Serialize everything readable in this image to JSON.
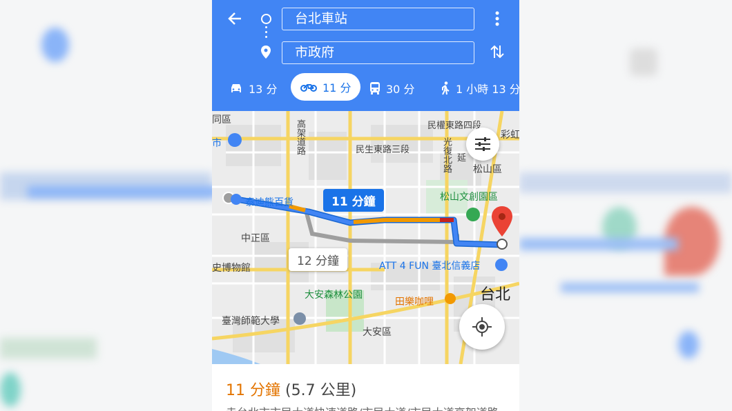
{
  "header": {
    "origin": "台北車站",
    "destination": "市政府"
  },
  "modes": [
    {
      "icon": "car-icon",
      "label": "13 分"
    },
    {
      "icon": "motorcycle-icon",
      "label": "11 分"
    },
    {
      "icon": "bus-icon",
      "label": "30 分"
    },
    {
      "icon": "walk-icon",
      "label": "1 小時 13 分"
    }
  ],
  "map": {
    "labels": {
      "district_datong": "同區",
      "xinnan_market": "市",
      "elevated": "高架道路",
      "minquan": "民權東路四段",
      "minsheng": "民生東路三段",
      "guangfu": "光復北路",
      "rainbow": "彩虹",
      "songshan": "松山區",
      "songshan_park": "松山文創園區",
      "teddy": "泰迪熊百貨",
      "zhongzheng": "中正區",
      "museum": "史博物館",
      "att": "ATT 4 FUN 臺北信義店",
      "taipei": "台北",
      "daan_park": "大安森林公園",
      "tianle": "田樂咖哩",
      "ntnu": "臺灣師範大學",
      "daan": "大安區",
      "yan": "延"
    },
    "route_label": "11 分鐘",
    "alt_route_label": "12 分鐘"
  },
  "summary": {
    "time": "11 分鐘",
    "distance": "(5.7 公里)",
    "route_desc": "走台北市市民大道快速道路/市民大道/市民大道高架道路"
  },
  "colors": {
    "header_bg": "#4185f4",
    "route": "#4285f4",
    "route_traffic": "#f29900",
    "pin": "#ea4335",
    "time_text": "#e37400"
  }
}
